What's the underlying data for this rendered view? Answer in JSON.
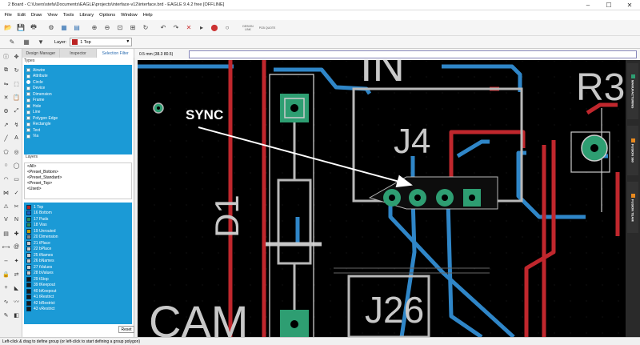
{
  "window": {
    "title": "2 Board - C:\\Users\\stefa\\Documents\\EAGLE\\projects\\interface-v12\\interface.brd - EAGLE 9.4.2 free [OFFLINE]",
    "controls": [
      "–",
      "☐",
      "✕"
    ]
  },
  "menu": [
    "File",
    "Edit",
    "Draw",
    "View",
    "Tools",
    "Library",
    "Options",
    "Window",
    "Help"
  ],
  "toolbar": {
    "design_link": "DESIGN LINK",
    "pcb_quote": "PCB QUOTE"
  },
  "layer_bar": {
    "label": "Layer:",
    "selected": "1 Top",
    "selected_color": "#b22222"
  },
  "panel": {
    "tabs": [
      "Design Manager",
      "Inspector",
      "Selection Filter"
    ],
    "active_tab": "Selection Filter",
    "types_header": "Types",
    "types": [
      "Airwire",
      "Attribute",
      "Circle",
      "Device",
      "Dimension",
      "Frame",
      "Hole",
      "Line",
      "Polygon Edge",
      "Rectangle",
      "Text",
      "Via"
    ],
    "layers_header": "Layers",
    "presets": [
      "<All>",
      "<Preset_Bottom>",
      "<Preset_Standard>",
      "<Preset_Top>",
      "<Used>"
    ],
    "layers": [
      {
        "name": "1 Top",
        "color": "#b22222"
      },
      {
        "name": "16 Bottom",
        "color": "#1e5fbf"
      },
      {
        "name": "17 Pads",
        "color": "#2e8b57"
      },
      {
        "name": "18 Vias",
        "color": "#2e8b57"
      },
      {
        "name": "19 Unrouted",
        "color": "#c8a000"
      },
      {
        "name": "20 Dimension",
        "color": "#888888"
      },
      {
        "name": "21 tPlace",
        "color": "#cccccc"
      },
      {
        "name": "22 bPlace",
        "color": "#cccccc"
      },
      {
        "name": "25 tNames",
        "color": "#cccccc"
      },
      {
        "name": "26 bNames",
        "color": "#cccccc"
      },
      {
        "name": "27 tValues",
        "color": "#cccccc"
      },
      {
        "name": "28 bValues",
        "color": "#cccccc"
      },
      {
        "name": "29 tStop",
        "color": "#1a1a1a"
      },
      {
        "name": "39 tKeepout",
        "color": "#1a1a1a"
      },
      {
        "name": "40 bKeepout",
        "color": "#1a1a1a"
      },
      {
        "name": "41 tRestrict",
        "color": "#1a1a1a"
      },
      {
        "name": "42 bRestrict",
        "color": "#1a1a1a"
      },
      {
        "name": "43 vRestrict",
        "color": "#1a1a1a"
      }
    ],
    "reset_label": "Reset"
  },
  "coord": "0.5 mm (38.3 80.5)",
  "canvas": {
    "labels": {
      "in": "IN",
      "r3": "R3",
      "j4": "J4",
      "d1": "D1",
      "cam": "CAM",
      "j26": "J26"
    },
    "annotation": "SYNC",
    "colors": {
      "top": "#c0272d",
      "bottom": "#2f86c8",
      "pad": "#2e9e72",
      "silk": "#c8c8c8"
    }
  },
  "right_tabs": [
    "MANUFACTURING",
    "FUSION 360",
    "FUSION TEAM"
  ],
  "status": "Left-click & drag to define group (or left-click to start defining a group polygon)"
}
